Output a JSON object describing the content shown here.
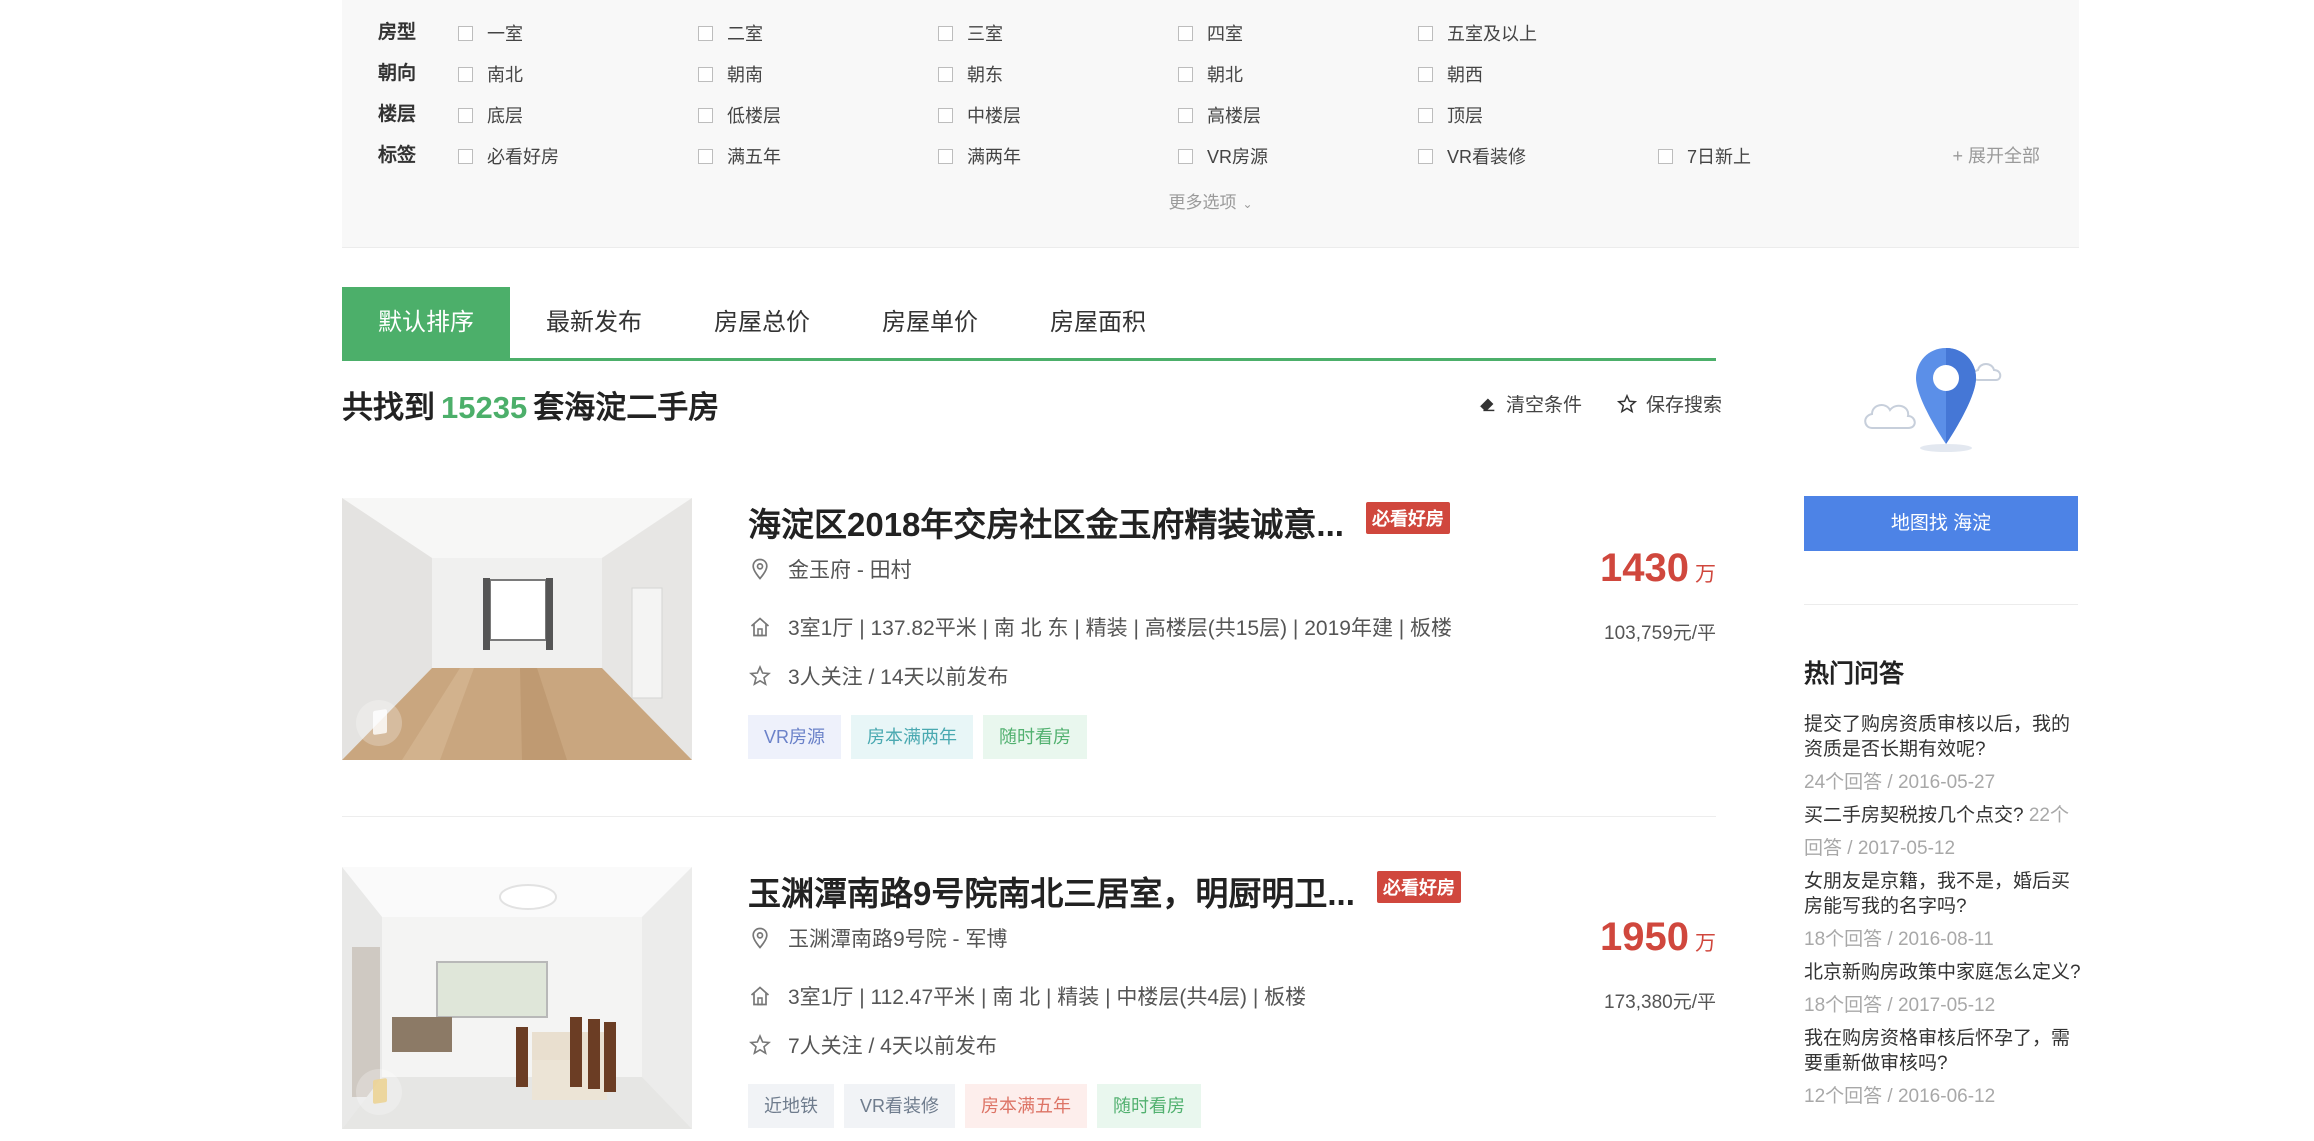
{
  "filters": {
    "rows": [
      {
        "label": "房型",
        "options": [
          "一室",
          "二室",
          "三室",
          "四室",
          "五室及以上"
        ]
      },
      {
        "label": "朝向",
        "options": [
          "南北",
          "朝南",
          "朝东",
          "朝北",
          "朝西"
        ]
      },
      {
        "label": "楼层",
        "options": [
          "底层",
          "低楼层",
          "中楼层",
          "高楼层",
          "顶层"
        ]
      },
      {
        "label": "标签",
        "options": [
          "必看好房",
          "满五年",
          "满两年",
          "VR房源",
          "VR看装修",
          "7日新上"
        ]
      }
    ],
    "expand_all": "+ 展开全部",
    "more_options": "更多选项"
  },
  "sort": {
    "tabs": [
      "默认排序",
      "最新发布",
      "房屋总价",
      "房屋单价",
      "房屋面积"
    ]
  },
  "result": {
    "prefix": "共找到",
    "count": "15235",
    "suffix": "套海淀二手房",
    "clear": "清空条件",
    "save": "保存搜索"
  },
  "listings": [
    {
      "title": "海淀区2018年交房社区金玉府精装诚意...",
      "badge": "必看好房",
      "location": "金玉府 - 田村",
      "info": "3室1厅 | 137.82平米 | 南 北 东 | 精装 | 高楼层(共15层) | 2019年建 | 板楼",
      "follow": "3人关注 / 14天以前发布",
      "tags": [
        "VR房源",
        "房本满两年",
        "随时看房"
      ],
      "price": "1430",
      "price_unit": "万",
      "unit_price": "103,759元/平"
    },
    {
      "title": "玉渊潭南路9号院南北三居室，明厨明卫...",
      "badge": "必看好房",
      "location": "玉渊潭南路9号院 - 军博",
      "info": "3室1厅 | 112.47平米 | 南 北 | 精装 | 中楼层(共4层) | 板楼",
      "follow": "7人关注 / 4天以前发布",
      "tags": [
        "近地铁",
        "VR看装修",
        "房本满五年",
        "随时看房"
      ],
      "price": "1950",
      "price_unit": "万",
      "unit_price": "173,380元/平"
    }
  ],
  "sidebar": {
    "map_button": "地图找 海淀",
    "faq_title": "热门问答",
    "faq": [
      {
        "q": "提交了购房资质审核以后，我的资质是否长期有效呢?",
        "meta": "24个回答 / 2016-05-27"
      },
      {
        "q": "买二手房契税按几个点交?",
        "meta_inline": "22个",
        "meta": "回答 / 2017-05-12"
      },
      {
        "q": "女朋友是京籍，我不是，婚后买房能写我的名字吗?",
        "meta": "18个回答 / 2016-08-11"
      },
      {
        "q": "北京新购房政策中家庭怎么定义?",
        "meta": "18个回答 / 2017-05-12"
      },
      {
        "q": "我在购房资格审核后怀孕了，需要重新做审核吗?",
        "meta": "12个回答 / 2016-06-12"
      }
    ]
  },
  "colors": {
    "accent_green": "#4caf6a",
    "price_red": "#d0473d",
    "map_blue": "#4d83e6"
  }
}
